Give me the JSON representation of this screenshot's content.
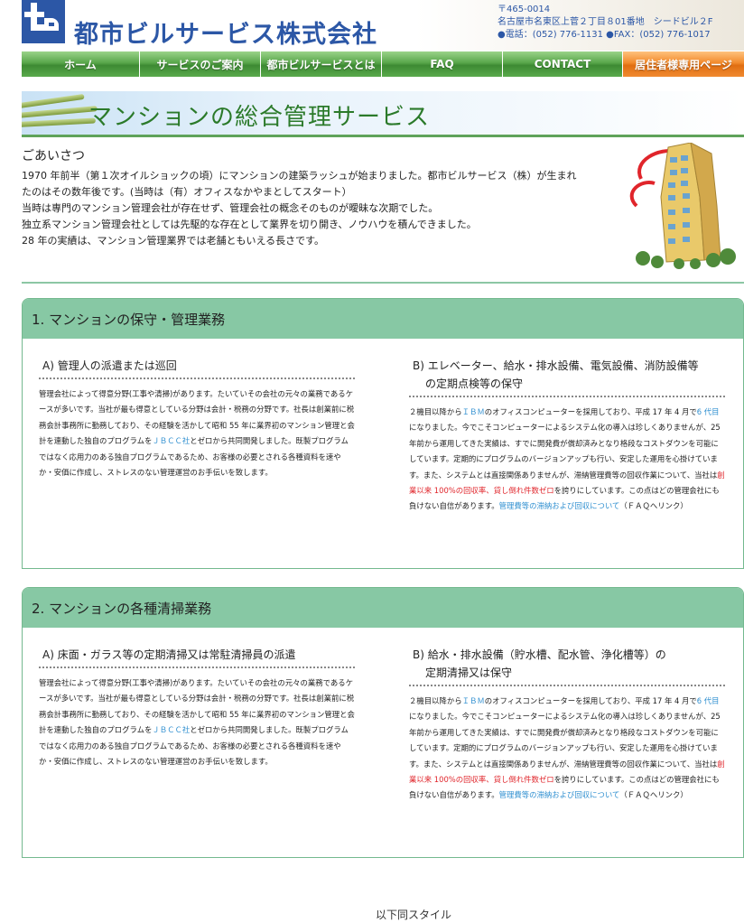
{
  "header": {
    "company_name": "都市ビルサービス株式会社",
    "address_lines": [
      "〒465-0014",
      "名古屋市名東区上菅２丁目８01番地　シードビル２F",
      "●電話：(052) 776-1131 ●FAX：(052) 776-1017"
    ]
  },
  "nav": [
    {
      "label": "ホーム"
    },
    {
      "label": "サービスのご案内"
    },
    {
      "label": "都市ビルサービスとは"
    },
    {
      "label": "FAQ"
    },
    {
      "label": "CONTACT"
    },
    {
      "label": "居住者様専用ページ"
    }
  ],
  "banner": {
    "title": "マンションの総合管理サービス"
  },
  "greeting": {
    "title": "ごあいさつ",
    "lines": [
      "1970 年前半（第１次オイルショックの頃）にマンションの建築ラッシュが始まりました。都市ビルサービス（株）が生まれ",
      "たのはその数年後です。(当時は（有）オフィスなかやまとしてスタート）",
      "当時は専門のマンション管理会社が存在せず、管理会社の概念そのものが曖昧な次期でした。",
      "独立系マンション管理会社としては先駆的な存在として業界を切り開き、ノウハウを積んできました。",
      "28 年の実績は、マンション管理業界では老舗ともいえる長さです。"
    ]
  },
  "sections": [
    {
      "title": "1. マンションの保守・管理業務",
      "left": {
        "heading": "A) 管理人の派遣または巡回",
        "text_pre": "管理会社によって得意分野(工事や清掃)があります。たいていその会社の元々の業務であるケースが多いです。当社が最も得意としている分野は会計・税務の分野です。社長は創業前に税務会計事務所に勤務しており、その経験を活かして昭和 55 年に業界初のマンション管理と会計を連動した独自のプログラムを",
        "link": "ＪＢＣＣ社",
        "text_post": "とゼロから共同開発しました。既製プログラムではなく応用力のある独自プログラムであるため、お客様の必要とされる各種資料を速やか・安価に作成し、ストレスのない管理運営のお手伝いを致します。"
      },
      "right": {
        "heading_line1": "B) エレベーター、給水・排水設備、電気設備、消防設備等",
        "heading_line2": "の定期点検等の保守",
        "t1": "２機目以降から",
        "ibm": "ＩＢＭ",
        "t2": "のオフィスコンピューターを採用しており、平成 17 年 4 月で",
        "gen": "6 代目",
        "t3": "になりました。今でこそコンピューターによるシステム化の導入は珍しくありませんが、25 年前から運用してきた実績は、すでに開発費が償却済みとなり格段なコストダウンを可能にしています。定期的にプログラムのバージョンアップも行い、安定した運用を心掛けています。また、システムとは直接関係ありませんが、滞納管理費等の回収作業について、当社は",
        "red": "創業以来 100%の回収率、貸し倒れ件数ゼロ",
        "t4": "を誇りにしています。この点はどの管理会社にも負けない自信があります。",
        "faq_link": "管理費等の滞納および回収について",
        "t5": "（ＦＡＱへリンク）"
      }
    },
    {
      "title": "2. マンションの各種清掃業務",
      "left": {
        "heading": "A) 床面・ガラス等の定期清掃又は常駐清掃員の派遣",
        "text_pre": "管理会社によって得意分野(工事や清掃)があります。たいていその会社の元々の業務であるケースが多いです。当社が最も得意としている分野は会計・税務の分野です。社長は創業前に税務会計事務所に勤務しており、その経験を活かして昭和 55 年に業界初のマンション管理と会計を連動した独自のプログラムを",
        "link": "ＪＢＣＣ社",
        "text_post": "とゼロから共同開発しました。既製プログラムではなく応用力のある独自プログラムであるため、お客様の必要とされる各種資料を速やか・安価に作成し、ストレスのない管理運営のお手伝いを致します。"
      },
      "right": {
        "heading_line1": "B) 給水・排水設備（貯水槽、配水管、浄化槽等）の",
        "heading_line2": "定期清掃又は保守",
        "t1": "２機目以降から",
        "ibm": "ＩＢＭ",
        "t2": "のオフィスコンピューターを採用しており、平成 17 年 4 月で",
        "gen": "6 代目",
        "t3": "になりました。今でこそコンピューターによるシステム化の導入は珍しくありませんが、25 年前から運用してきた実績は、すでに開発費が償却済みとなり格段なコストダウンを可能にしています。定期的にプログラムのバージョンアップも行い、安定した運用を心掛けています。また、システムとは直接関係ありませんが、滞納管理費等の回収作業について、当社は",
        "red": "創業以来 100%の回収率、貸し倒れ件数ゼロ",
        "t4": "を誇りにしています。この点はどの管理会社にも負けない自信があります。",
        "faq_link": "管理費等の滞納および回収について",
        "t5": "（ＦＡＱへリンク）"
      }
    }
  ],
  "footer": {
    "note": "以下同スタイル"
  },
  "colors": {
    "brand_blue": "#2c57a6",
    "nav_green": "#58a64a",
    "nav_orange": "#f28a2c",
    "section_header_green": "#87c8a4",
    "link_blue": "#2f8fd0",
    "highlight_red": "#e0252b"
  }
}
